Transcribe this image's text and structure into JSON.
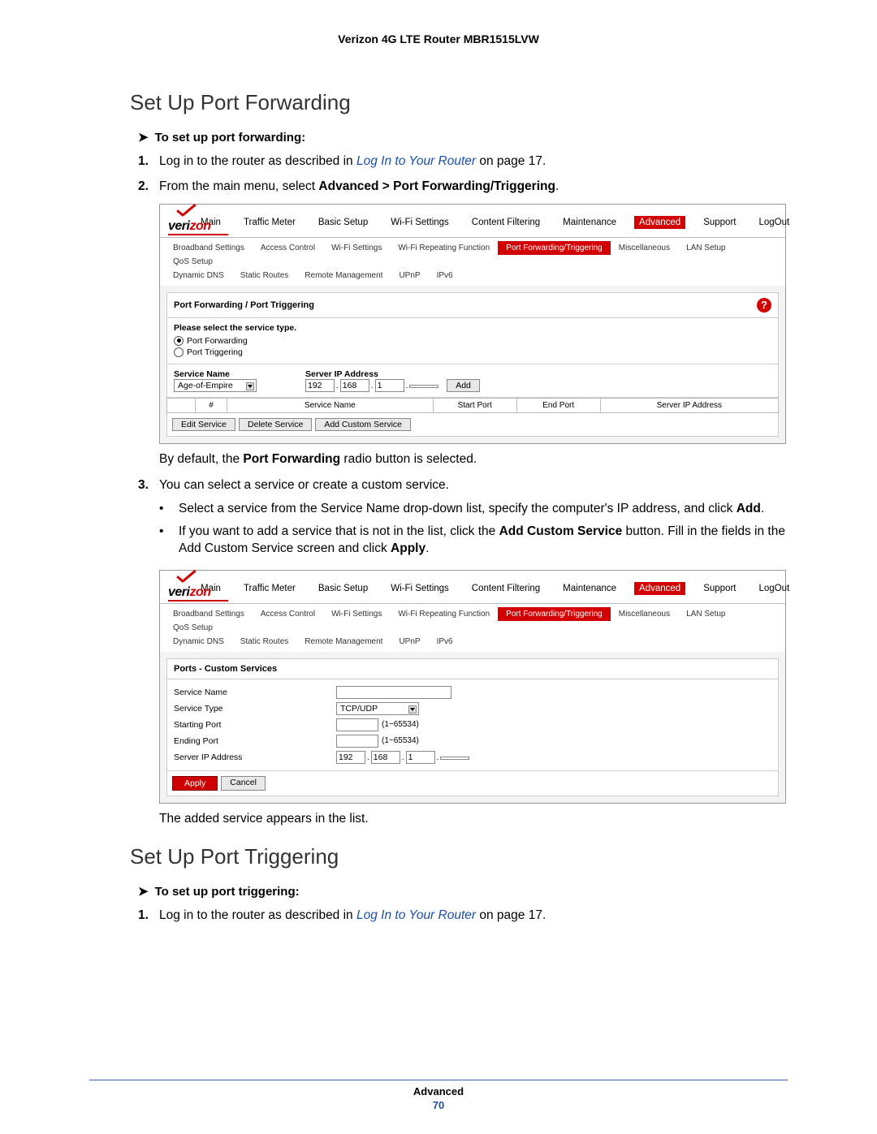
{
  "header": {
    "title": "Verizon 4G LTE Router MBR1515LVW"
  },
  "h2_1": "Set Up Port Forwarding",
  "task1": "To set up port forwarding:",
  "step1_pre": "Log in to the router as described in ",
  "step1_link": "Log In to Your Router",
  "step1_post": " on page 17.",
  "step2_pre": "From the main menu, select ",
  "step2_bold": "Advanced > Port Forwarding/Triggering",
  "step2_post": ".",
  "after_shot1_pre": "By default, the ",
  "after_shot1_bold": "Port Forwarding",
  "after_shot1_post": " radio button is selected.",
  "step3": "You can select a service or create a custom service.",
  "b1_pre": "Select a service from the Service Name drop-down list, specify the computer's IP address, and click ",
  "b1_bold": "Add",
  "b1_post": ".",
  "b2_pre": "If you want to add a service that is not in the list, click the ",
  "b2_bold": "Add Custom Service",
  "b2_post1": " button. Fill in the fields in the Add Custom Service screen and click ",
  "b2_bold2": "Apply",
  "b2_post2": ".",
  "after_shot2": "The added service appears in the list.",
  "h2_2": "Set Up Port Triggering",
  "task2": "To set up port triggering:",
  "stepT1_pre": "Log in to the router as described in ",
  "stepT1_link": "Log In to Your Router",
  "stepT1_post": " on page 17.",
  "footer": {
    "section": "Advanced",
    "page": "70"
  },
  "logo": {
    "pre": "veri",
    "post": "zon"
  },
  "nav_top": [
    "Main",
    "Traffic Meter",
    "Basic Setup",
    "Wi-Fi Settings",
    "Content Filtering",
    "Maintenance",
    "Advanced",
    "Support",
    "LogOut"
  ],
  "nav_sub1": [
    "Broadband Settings",
    "Access Control",
    "Wi-Fi Settings",
    "Wi-Fi Repeating Function",
    "Port Forwarding/Triggering",
    "Miscellaneous",
    "LAN Setup",
    "QoS Setup"
  ],
  "nav_sub2": [
    "Dynamic DNS",
    "Static Routes",
    "Remote Management",
    "UPnP",
    "IPv6"
  ],
  "shot1": {
    "title": "Port Forwarding / Port Triggering",
    "select_hdr": "Please select the service type.",
    "radio_pf": "Port Forwarding",
    "radio_pt": "Port Triggering",
    "service_name_hdr": "Service Name",
    "server_ip_hdr": "Server IP Address",
    "service_sel": "Age-of-Empire",
    "ip": {
      "a": "192",
      "b": "168",
      "c": "1",
      "d": ""
    },
    "add_btn": "Add",
    "thead": {
      "chk": "",
      "num": "#",
      "sn": "Service Name",
      "sp": "Start Port",
      "ep": "End Port",
      "ip": "Server IP Address"
    },
    "btns": {
      "edit": "Edit Service",
      "del": "Delete Service",
      "add": "Add Custom Service"
    }
  },
  "shot2": {
    "title": "Ports - Custom Services",
    "rows": {
      "sn": "Service Name",
      "st": "Service Type",
      "sp": "Starting Port",
      "ep": "Ending Port",
      "ip": "Server IP Address"
    },
    "st_sel": "TCP/UDP",
    "hint": "(1~65534)",
    "ip": {
      "a": "192",
      "b": "168",
      "c": "1",
      "d": ""
    },
    "apply": "Apply",
    "cancel": "Cancel"
  },
  "help_q": "?"
}
